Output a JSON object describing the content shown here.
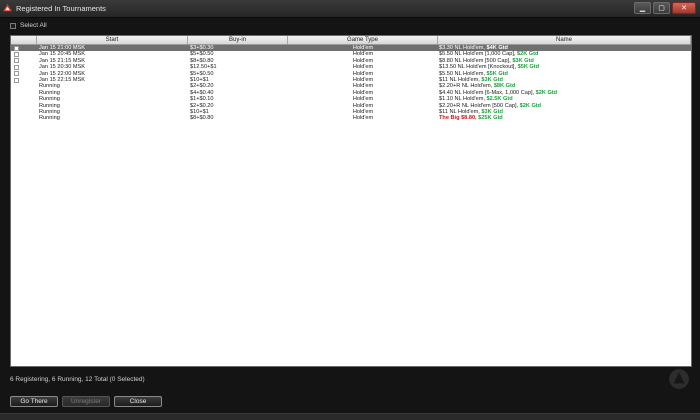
{
  "window": {
    "title": "Registered In Tournaments"
  },
  "select_all": {
    "label": "Select All"
  },
  "table": {
    "headers": [
      "Start",
      "Buy-in",
      "Game Type",
      "Name"
    ],
    "rows": [
      {
        "checkbox": true,
        "start": "Jan 15  21:00 MSK",
        "buyin": "$3+$0.30",
        "game": "Hold'em",
        "name": "$3.30 NL Hold'em, ",
        "tag": "$4K Gtd",
        "selected": true
      },
      {
        "checkbox": true,
        "start": "Jan 15  20:45 MSK",
        "buyin": "$5+$0.50",
        "game": "Hold'em",
        "name": "$5.50 NL Hold'em [1,000 Cap], ",
        "tag": "$2K Gtd"
      },
      {
        "checkbox": true,
        "start": "Jan 15  21:15 MSK",
        "buyin": "$8+$0.80",
        "game": "Hold'em",
        "name": "$8.80 NL Hold'em [500 Cap], ",
        "tag": "$3K Gtd"
      },
      {
        "checkbox": true,
        "start": "Jan 15  20:30 MSK",
        "buyin": "$12.50+$1",
        "game": "Hold'em",
        "name": "$13.50 NL Hold'em [Knockout], ",
        "tag": "$5K Gtd"
      },
      {
        "checkbox": true,
        "start": "Jan 15  22:00 MSK",
        "buyin": "$5+$0.50",
        "game": "Hold'em",
        "name": "$5.50 NL Hold'em, ",
        "tag": "$5K Gtd"
      },
      {
        "checkbox": true,
        "start": "Jan 15  22:15 MSK",
        "buyin": "$10+$1",
        "game": "Hold'em",
        "name": "$11 NL Hold'em, ",
        "tag": "$3K Gtd"
      },
      {
        "checkbox": false,
        "start": "Running",
        "buyin": "$2+$0.20",
        "game": "Hold'em",
        "name": "$2.20+R NL Hold'em, ",
        "tag": "$8K Gtd"
      },
      {
        "checkbox": false,
        "start": "Running",
        "buyin": "$4+$0.40",
        "game": "Hold'em",
        "name": "$4.40 NL Hold'em [6-Max, 1,000 Cap], ",
        "tag": "$2K Gtd"
      },
      {
        "checkbox": false,
        "start": "Running",
        "buyin": "$1+$0.10",
        "game": "Hold'em",
        "name": "$1.10 NL Hold'em, ",
        "tag": "$2.5K Gtd"
      },
      {
        "checkbox": false,
        "start": "Running",
        "buyin": "$2+$0.20",
        "game": "Hold'em",
        "name": "$2.20+R NL Hold'em [500 Cap], ",
        "tag": "$2K Gtd"
      },
      {
        "checkbox": false,
        "start": "Running",
        "buyin": "$10+$1",
        "game": "Hold'em",
        "name": "$11 NL Hold'em, ",
        "tag": "$3K Gtd"
      },
      {
        "checkbox": false,
        "start": "Running",
        "buyin": "$8+$0.80",
        "game": "Hold'em",
        "name_red": "The Big $8.80, ",
        "tag": "$25K Gtd"
      }
    ]
  },
  "status": {
    "text": "6 Registering, 6 Running, 12 Total (0 Selected)"
  },
  "buttons": {
    "go_there": "Go There",
    "unregister": "Unregister",
    "close": "Close"
  },
  "colors": {
    "tag_green": "#1aa33a",
    "highlight_red": "#d11414",
    "selected_row": "#6f6f6f"
  }
}
